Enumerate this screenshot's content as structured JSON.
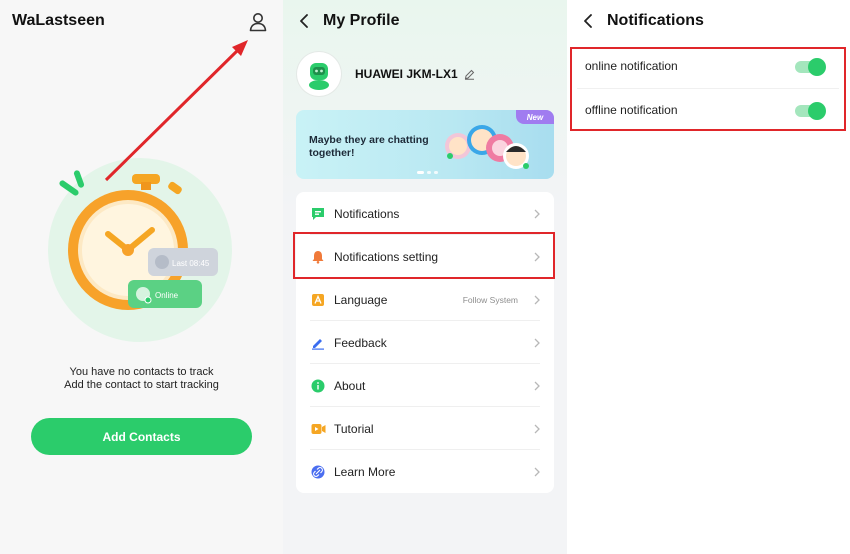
{
  "home": {
    "app_title": "WaLastseen",
    "illustration": {
      "last_label": "Last 08:45",
      "online_label": "Online"
    },
    "empty_line1": "You have no contacts to track",
    "empty_line2": "Add the contact to start tracking",
    "add_button": "Add Contacts",
    "icons": {
      "user": "user-icon"
    }
  },
  "profile": {
    "title": "My Profile",
    "device_name": "HUAWEI JKM-LX1",
    "banner": {
      "text": "Maybe they are chatting together!",
      "badge": "New"
    },
    "menu": [
      {
        "label": "Notifications",
        "icon": "notifications-icon",
        "color": "#2bcc6b"
      },
      {
        "label": "Notifications setting",
        "icon": "bell-icon",
        "color": "#f07a3a"
      },
      {
        "label": "Language",
        "icon": "language-icon",
        "color": "#f5a623",
        "value": "Follow System"
      },
      {
        "label": "Feedback",
        "icon": "pen-icon",
        "color": "#3a6df0"
      },
      {
        "label": "About",
        "icon": "info-icon",
        "color": "#2bcc6b"
      },
      {
        "label": "Tutorial",
        "icon": "video-icon",
        "color": "#f5a623"
      },
      {
        "label": "Learn More",
        "icon": "link-icon",
        "color": "#4b6ef0"
      }
    ]
  },
  "notifications": {
    "title": "Notifications",
    "toggles": [
      {
        "label": "online notification",
        "on": true
      },
      {
        "label": "offline notification",
        "on": true
      }
    ]
  },
  "colors": {
    "accent": "#2bcc6b",
    "annotation_red": "#e0262a"
  }
}
